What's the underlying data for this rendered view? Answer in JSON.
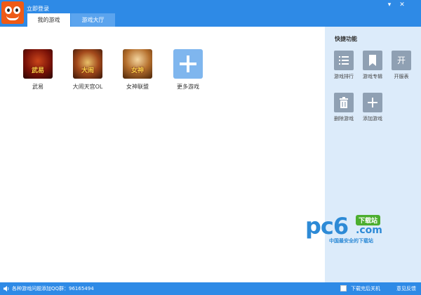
{
  "window": {
    "login_link": "立即登录",
    "minimize_symbol": "▾",
    "close_symbol": "✕"
  },
  "tabs": [
    {
      "label": "我的游戏",
      "active": true
    },
    {
      "label": "游戏大厅",
      "active": false
    }
  ],
  "games": [
    {
      "name": "武易",
      "thumb_text": "武易"
    },
    {
      "name": "大闹天宫OL",
      "thumb_text": "大闹"
    },
    {
      "name": "女神联盟",
      "thumb_text": "女神"
    },
    {
      "name": "更多游戏",
      "thumb_text": ""
    }
  ],
  "quick": {
    "title": "快捷功能",
    "items": [
      {
        "label": "游戏排行",
        "icon": "list-icon"
      },
      {
        "label": "游戏专辑",
        "icon": "bookmark-icon"
      },
      {
        "label": "开服表",
        "icon": "kai-icon",
        "glyph": "开"
      },
      {
        "label": "删除游戏",
        "icon": "trash-icon"
      },
      {
        "label": "添加游戏",
        "icon": "plus-icon"
      }
    ]
  },
  "watermark": {
    "big": "pc6",
    "badge": "下载站",
    "com": ".com",
    "sub": "中国最安全的下载站"
  },
  "status": {
    "qq_group_text": "各种游戏问题添加QQ群：96165494",
    "shutdown_label": "下载完后关机",
    "shutdown_checked": false,
    "feedback_label": "意见反馈"
  },
  "colors": {
    "brand_blue": "#2e8ae6",
    "side_panel": "#dcebfa",
    "logo_orange": "#ee5a16",
    "icon_gray": "#8fa0b3"
  }
}
